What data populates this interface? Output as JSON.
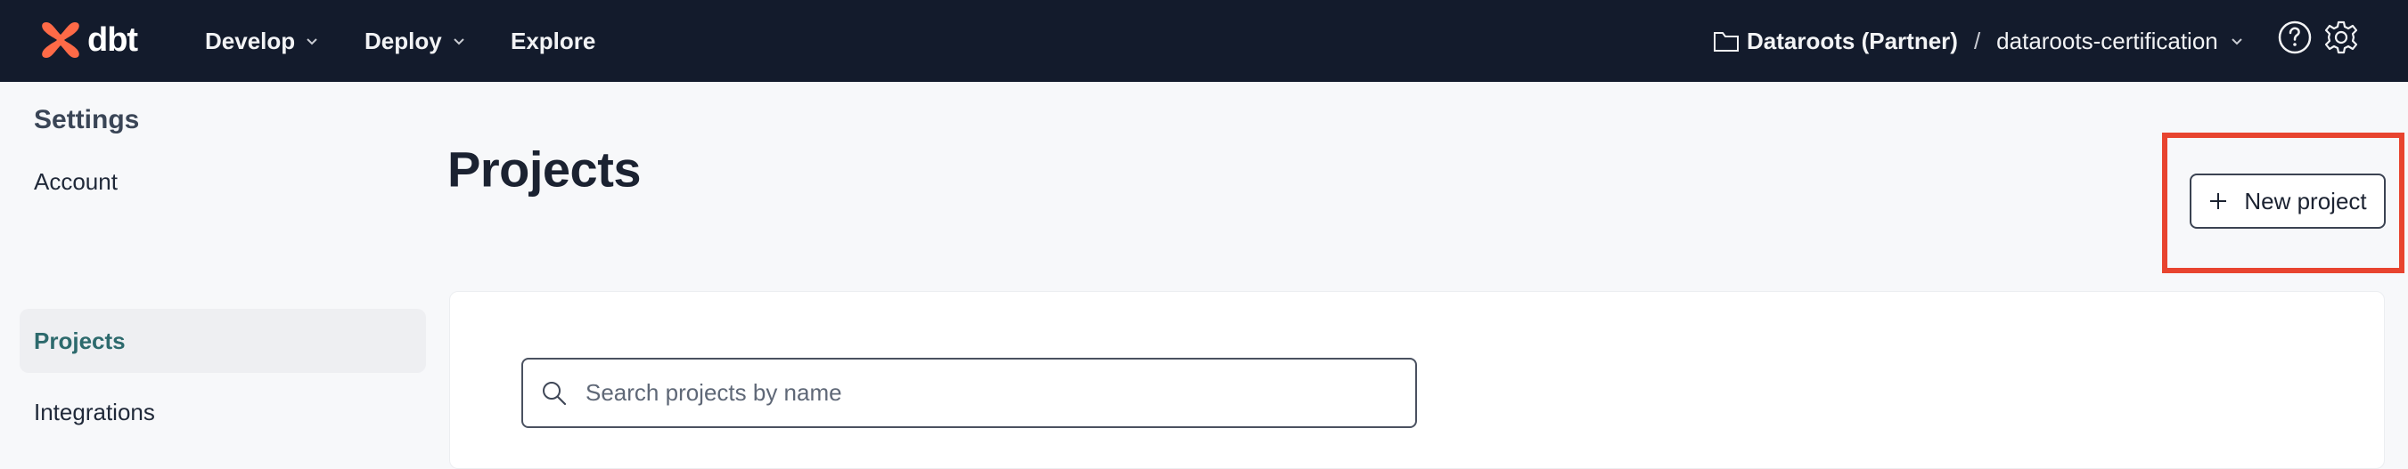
{
  "brand": {
    "name": "dbt"
  },
  "nav": [
    {
      "label": "Develop",
      "has_menu": true
    },
    {
      "label": "Deploy",
      "has_menu": true
    },
    {
      "label": "Explore",
      "has_menu": false
    }
  ],
  "breadcrumb": {
    "account": "Dataroots (Partner)",
    "separator": "/",
    "project": "dataroots-certification"
  },
  "top_icons": [
    "question-circle-icon",
    "gear-icon"
  ],
  "sidebar": {
    "title": "Settings",
    "items": [
      {
        "label": "Account",
        "active": false
      },
      {
        "label": "Projects",
        "active": true
      },
      {
        "label": "Integrations",
        "active": false
      }
    ]
  },
  "main": {
    "title": "Projects",
    "new_button_label": "New project",
    "search": {
      "placeholder": "Search projects by name",
      "value": ""
    }
  },
  "colors": {
    "topbar": "#131b2c",
    "brand_orange": "#fe6a47",
    "active_item_text": "#2d6a6d",
    "highlight_box": "#e8442f"
  }
}
